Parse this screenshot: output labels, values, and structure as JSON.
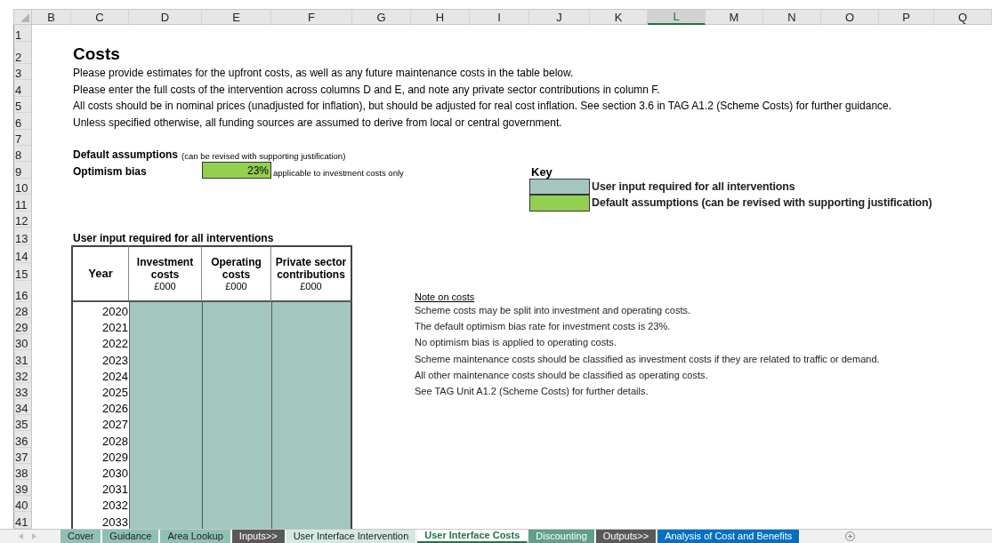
{
  "column_headers": [
    {
      "label": "B",
      "selected": false
    },
    {
      "label": "C",
      "selected": false
    },
    {
      "label": "D",
      "selected": false
    },
    {
      "label": "E",
      "selected": false
    },
    {
      "label": "F",
      "selected": false
    },
    {
      "label": "G",
      "selected": false
    },
    {
      "label": "H",
      "selected": false
    },
    {
      "label": "I",
      "selected": false
    },
    {
      "label": "J",
      "selected": false
    },
    {
      "label": "K",
      "selected": false
    },
    {
      "label": "L",
      "selected": true
    },
    {
      "label": "M",
      "selected": false
    },
    {
      "label": "N",
      "selected": false
    },
    {
      "label": "O",
      "selected": false
    },
    {
      "label": "P",
      "selected": false
    },
    {
      "label": "Q",
      "selected": false
    }
  ],
  "row_headers": [
    "1",
    "2",
    "3",
    "4",
    "5",
    "6",
    "7",
    "8",
    "9",
    "10",
    "11",
    "12",
    "13",
    "14",
    "15",
    "16",
    "28",
    "29",
    "30",
    "31",
    "32",
    "33",
    "34",
    "35",
    "36",
    "37",
    "38",
    "39",
    "40",
    "41"
  ],
  "title": "Costs",
  "instructions": [
    "Please provide estimates for the upfront costs, as well as any future maintenance costs in the table below.",
    "Please enter the full costs of the intervention across columns D and E, and note any private sector contributions in column F.",
    "All costs should be in nominal prices (unadjusted for inflation), but should be adjusted for real cost inflation. See section 3.6 in TAG A1.2 (Scheme Costs) for further guidance.",
    "Unless specified otherwise, all funding sources are assumed to derive from local or central government."
  ],
  "default_assumptions": {
    "heading": "Default assumptions",
    "note": "(can be revised with supporting justification)",
    "optimism_bias": {
      "label": "Optimism bias",
      "value": "23%",
      "note": "applicable to investment costs only"
    }
  },
  "key": {
    "title": "Key",
    "items": [
      {
        "label": "User input required for all interventions",
        "color": "#a3c7bf"
      },
      {
        "label": "Default assumptions (can be revised with supporting justification)",
        "color": "#92d050"
      }
    ]
  },
  "table": {
    "caption": "User input required for all interventions",
    "columns": [
      {
        "title": "Year"
      },
      {
        "title": "Investment costs",
        "unit": "£000"
      },
      {
        "title": "Operating costs",
        "unit": "£000"
      },
      {
        "title": "Private sector contributions",
        "unit": "£000"
      }
    ],
    "years": [
      "2020",
      "2021",
      "2022",
      "2023",
      "2024",
      "2025",
      "2026",
      "2027",
      "2028",
      "2029",
      "2030",
      "2031",
      "2032",
      "2033"
    ]
  },
  "note": {
    "title": "Note on costs",
    "lines": [
      "Scheme costs may be split into investment and operating costs.",
      "The default optimism bias rate for investment costs is 23%.",
      "No optimism bias is applied to operating costs.",
      "Scheme maintenance costs should be classified as investment costs if they are related to traffic or demand.",
      "All other maintenance costs should be classified as operating costs.",
      "See TAG Unit A1.2 (Scheme Costs) for further details."
    ]
  },
  "sheet_tabs": [
    {
      "label": "Cover",
      "color": "#8fc1b3",
      "selected": false
    },
    {
      "label": "Guidance",
      "color": "#8fc1b3",
      "selected": false
    },
    {
      "label": "Area Lookup",
      "color": "#8fc1b3",
      "selected": false
    },
    {
      "label": "Inputs>>",
      "color": "#595959",
      "selected": false
    },
    {
      "label": "User Interface Intervention",
      "color": "#d3e8e2",
      "selected": false
    },
    {
      "label": "User Interface Costs",
      "color": "#ffffff",
      "selected": true
    },
    {
      "label": "Discounting",
      "color": "#5f9f8c",
      "selected": false
    },
    {
      "label": "Outputs>>",
      "color": "#595959",
      "selected": false
    },
    {
      "label": "Analysis of Cost and Benefits",
      "color": "#0070c0",
      "selected": false
    }
  ]
}
